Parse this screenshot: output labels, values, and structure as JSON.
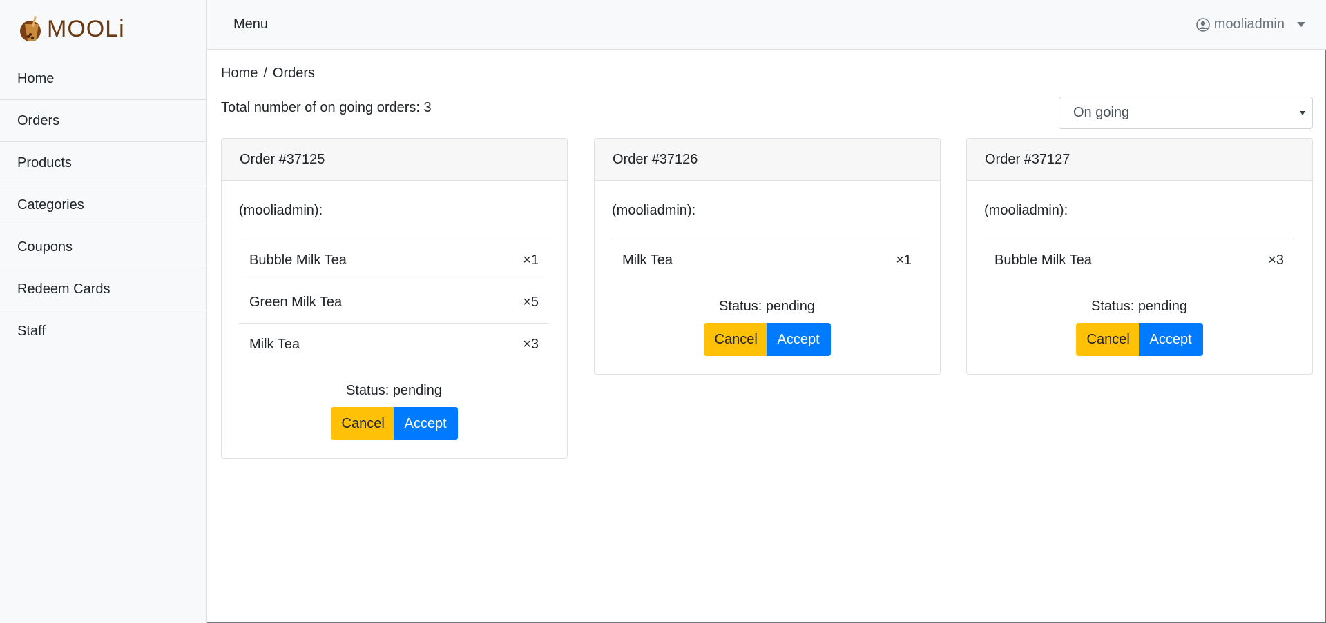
{
  "brand": {
    "logo_text": "MOOLi",
    "logo_color": "#6b3a10"
  },
  "sidebar": {
    "items": [
      {
        "label": "Home"
      },
      {
        "label": "Orders"
      },
      {
        "label": "Products"
      },
      {
        "label": "Categories"
      },
      {
        "label": "Coupons"
      },
      {
        "label": "Redeem Cards"
      },
      {
        "label": "Staff"
      }
    ]
  },
  "topbar": {
    "menu_label": "Menu",
    "user_icon": "user-circle-icon",
    "username": "mooliadmin"
  },
  "breadcrumb": {
    "home": "Home",
    "separator": "/",
    "current": "Orders"
  },
  "summary": {
    "total_text": "Total number of on going orders: 3"
  },
  "filter": {
    "selected": "On going"
  },
  "colors": {
    "cancel": "#ffc107",
    "accept": "#007bff"
  },
  "orders": [
    {
      "title": "Order #37125",
      "customer": "(mooliadmin):",
      "items": [
        {
          "name": "Bubble Milk Tea",
          "qty": "×1"
        },
        {
          "name": "Green Milk Tea",
          "qty": "×5"
        },
        {
          "name": "Milk Tea",
          "qty": "×3"
        }
      ],
      "status": "Status: pending",
      "cancel_label": "Cancel",
      "accept_label": "Accept"
    },
    {
      "title": "Order #37126",
      "customer": "(mooliadmin):",
      "items": [
        {
          "name": "Milk Tea",
          "qty": "×1"
        }
      ],
      "status": "Status: pending",
      "cancel_label": "Cancel",
      "accept_label": "Accept"
    },
    {
      "title": "Order #37127",
      "customer": "(mooliadmin):",
      "items": [
        {
          "name": "Bubble Milk Tea",
          "qty": "×3"
        }
      ],
      "status": "Status: pending",
      "cancel_label": "Cancel",
      "accept_label": "Accept"
    }
  ]
}
